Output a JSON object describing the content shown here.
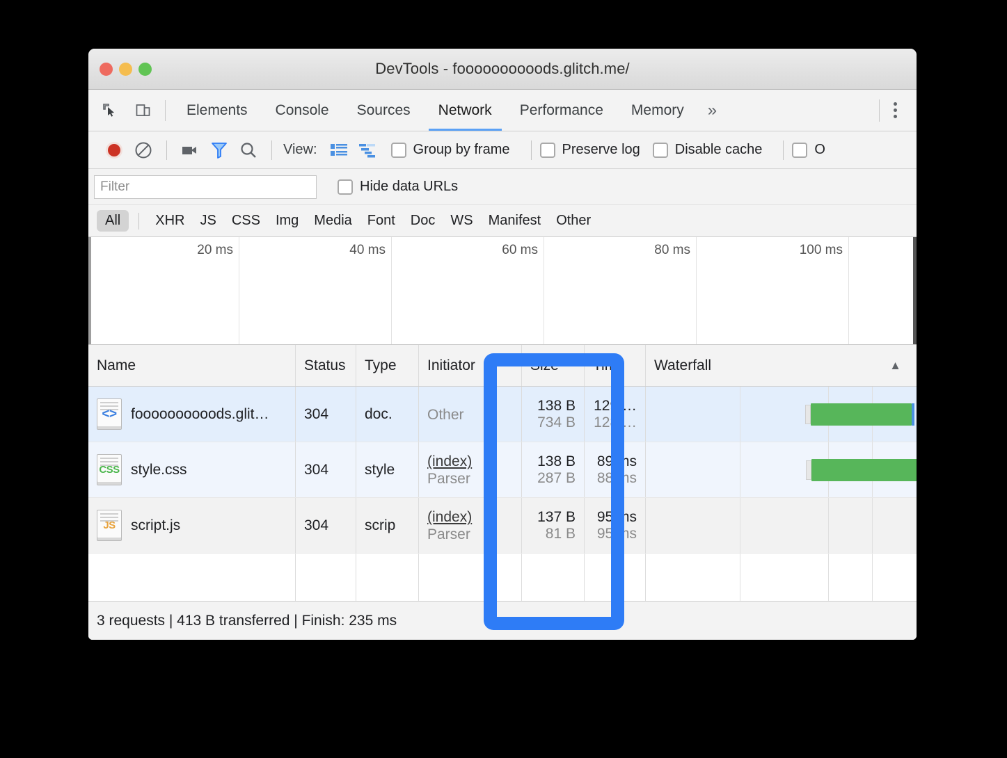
{
  "window": {
    "title": "DevTools - foooooooooods.glitch.me/",
    "traffic_lights": [
      "close",
      "minimize",
      "maximize"
    ]
  },
  "tabstrip": {
    "inspect_icon": "inspect-element-icon",
    "device_icon": "device-toolbar-icon",
    "tabs": [
      {
        "label": "Elements",
        "active": false
      },
      {
        "label": "Console",
        "active": false
      },
      {
        "label": "Sources",
        "active": false
      },
      {
        "label": "Network",
        "active": true
      },
      {
        "label": "Performance",
        "active": false
      },
      {
        "label": "Memory",
        "active": false
      }
    ],
    "more_tabs": "»",
    "menu_icon": "more-options-icon"
  },
  "controls": {
    "record_icon": "record-button-icon",
    "clear_icon": "clear-icon",
    "camera_icon": "capture-screenshots-icon",
    "filter_icon": "filter-funnel-icon",
    "search_icon": "search-icon",
    "view_label": "View:",
    "list_view_icon": "list-view-icon",
    "waterfall_view_icon": "waterfall-view-icon",
    "checkboxes": [
      {
        "label": "Group by frame",
        "checked": false
      },
      {
        "label": "Preserve log",
        "checked": false
      },
      {
        "label": "Disable cache",
        "checked": false
      }
    ],
    "clipped_checkbox_label": "O"
  },
  "filterbar": {
    "placeholder": "Filter",
    "value": "",
    "hide_data_urls": {
      "label": "Hide data URLs",
      "checked": false
    }
  },
  "typefilters": {
    "active": "All",
    "items": [
      "All",
      "XHR",
      "JS",
      "CSS",
      "Img",
      "Media",
      "Font",
      "Doc",
      "WS",
      "Manifest",
      "Other"
    ]
  },
  "overview": {
    "ticks": [
      "20 ms",
      "40 ms",
      "60 ms",
      "80 ms",
      "100 ms"
    ]
  },
  "table": {
    "columns": [
      "Name",
      "Status",
      "Type",
      "Initiator",
      "Size",
      "Time",
      "Waterfall"
    ],
    "sort_indicator": "▲",
    "rows": [
      {
        "icon": "html-document-icon",
        "icon_glyph": "<>",
        "name": "foooooooooods.glit…",
        "status": "304",
        "type": "doc.",
        "initiator_main": "Other",
        "initiator_sub": "",
        "size_main": "138 B",
        "size_sub": "734 B",
        "time_main": "129 …",
        "time_sub": "128 …"
      },
      {
        "icon": "css-document-icon",
        "icon_glyph": "CSS",
        "name": "style.css",
        "status": "304",
        "type": "style",
        "initiator_main": "(index)",
        "initiator_sub": "Parser",
        "size_main": "138 B",
        "size_sub": "287 B",
        "time_main": "89 ms",
        "time_sub": "88 ms"
      },
      {
        "icon": "js-document-icon",
        "icon_glyph": "JS",
        "name": "script.js",
        "status": "304",
        "type": "scrip",
        "initiator_main": "(index)",
        "initiator_sub": "Parser",
        "size_main": "137 B",
        "size_sub": "81 B",
        "time_main": "95 ms",
        "time_sub": "95 ms"
      }
    ]
  },
  "statusbar": {
    "text": "3 requests | 413 B transferred | Finish: 235 ms"
  },
  "highlight": {
    "target_column": "Initiator",
    "color": "#2e7cf6"
  },
  "colors": {
    "accent_blue": "#2e7cf6",
    "tab_underline": "#5ba1f5",
    "waterfall_bar_green": "#57b65a",
    "row_selected": "#e3eefc"
  }
}
